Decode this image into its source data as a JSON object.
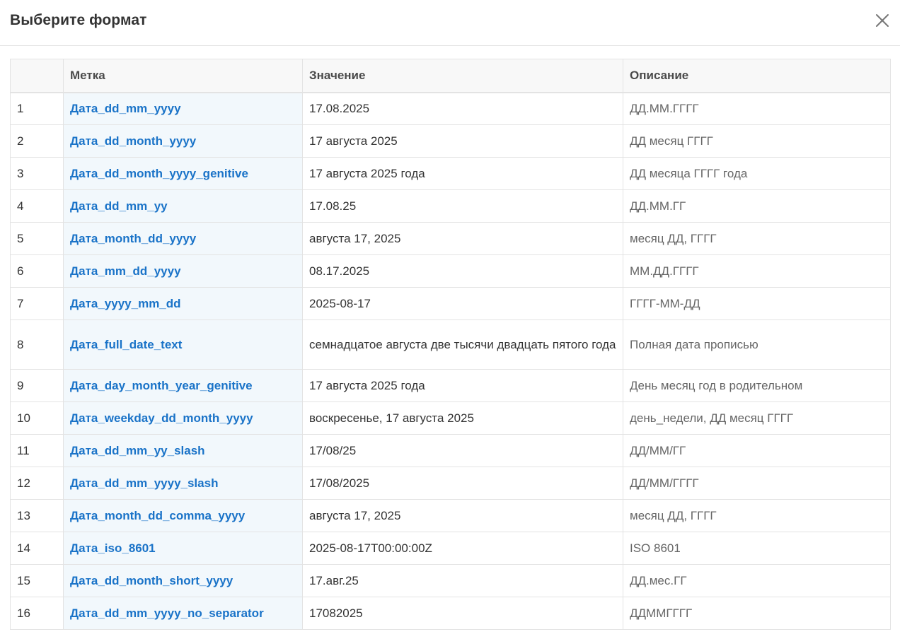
{
  "dialog": {
    "title": "Выберите формат"
  },
  "table": {
    "headers": {
      "num": "",
      "label": "Метка",
      "value": "Значение",
      "description": "Описание"
    },
    "rows": [
      {
        "num": "1",
        "label": "Дата_dd_mm_yyyy",
        "value": "17.08.2025",
        "description": "ДД.ММ.ГГГГ"
      },
      {
        "num": "2",
        "label": "Дата_dd_month_yyyy",
        "value": "17 августа 2025",
        "description": "ДД месяц ГГГГ"
      },
      {
        "num": "3",
        "label": "Дата_dd_month_yyyy_genitive",
        "value": "17 августа 2025 года",
        "description": "ДД месяца ГГГГ года"
      },
      {
        "num": "4",
        "label": "Дата_dd_mm_yy",
        "value": "17.08.25",
        "description": "ДД.ММ.ГГ"
      },
      {
        "num": "5",
        "label": "Дата_month_dd_yyyy",
        "value": "августа 17, 2025",
        "description": "месяц ДД, ГГГГ"
      },
      {
        "num": "6",
        "label": "Дата_mm_dd_yyyy",
        "value": "08.17.2025",
        "description": "ММ.ДД.ГГГГ"
      },
      {
        "num": "7",
        "label": "Дата_yyyy_mm_dd",
        "value": "2025-08-17",
        "description": "ГГГГ-ММ-ДД"
      },
      {
        "num": "8",
        "label": "Дата_full_date_text",
        "value": "семнадцатое августа две тысячи двадцать пятого года",
        "description": "Полная дата прописью"
      },
      {
        "num": "9",
        "label": "Дата_day_month_year_genitive",
        "value": "17 августа 2025 года",
        "description": "День месяц год в родительном"
      },
      {
        "num": "10",
        "label": "Дата_weekday_dd_month_yyyy",
        "value": "воскресенье, 17 августа 2025",
        "description": "день_недели, ДД месяц ГГГГ"
      },
      {
        "num": "11",
        "label": "Дата_dd_mm_yy_slash",
        "value": "17/08/25",
        "description": "ДД/ММ/ГГ"
      },
      {
        "num": "12",
        "label": "Дата_dd_mm_yyyy_slash",
        "value": "17/08/2025",
        "description": "ДД/ММ/ГГГГ"
      },
      {
        "num": "13",
        "label": "Дата_month_dd_comma_yyyy",
        "value": "августа 17, 2025",
        "description": "месяц ДД, ГГГГ"
      },
      {
        "num": "14",
        "label": "Дата_iso_8601",
        "value": "2025-08-17T00:00:00Z",
        "description": "ISO 8601"
      },
      {
        "num": "15",
        "label": "Дата_dd_month_short_yyyy",
        "value": "17.авг.25",
        "description": "ДД.мес.ГГ"
      },
      {
        "num": "16",
        "label": "Дата_dd_mm_yyyy_no_separator",
        "value": "17082025",
        "description": "ДДММГГГГ"
      }
    ]
  },
  "colors": {
    "link": "#1a73c8",
    "label_cell_bg": "#f2f8fc",
    "header_bg": "#f8f8f8",
    "border": "#e3e3e3"
  },
  "icons": {
    "close": "close-icon"
  }
}
